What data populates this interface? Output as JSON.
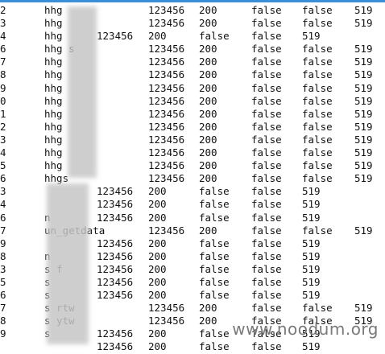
{
  "rows": [
    {
      "line": "2",
      "name": "hhg",
      "c1": "123456",
      "c2": "200",
      "c3": "false",
      "c4": "false",
      "c5": "519",
      "layout": "a"
    },
    {
      "line": "3",
      "name": "hhg",
      "c1": "123456",
      "c2": "200",
      "c3": "false",
      "c4": "false",
      "c5": "519",
      "layout": "a"
    },
    {
      "line": "4",
      "name": "hhg",
      "c1": "123456",
      "c2": "200",
      "c3": "false",
      "c4": "false",
      "c5": "519",
      "layout": "b"
    },
    {
      "line": "6",
      "name": "hhg           s",
      "c1": "123456",
      "c2": "200",
      "c3": "false",
      "c4": "false",
      "c5": "519",
      "layout": "a"
    },
    {
      "line": "7",
      "name": "hhg",
      "c1": "123456",
      "c2": "200",
      "c3": "false",
      "c4": "false",
      "c5": "519",
      "layout": "a"
    },
    {
      "line": "8",
      "name": "hhg",
      "c1": "123456",
      "c2": "200",
      "c3": "false",
      "c4": "false",
      "c5": "519",
      "layout": "a"
    },
    {
      "line": "9",
      "name": "hhg",
      "c1": "123456",
      "c2": "200",
      "c3": "false",
      "c4": "false",
      "c5": "519",
      "layout": "a"
    },
    {
      "line": "0",
      "name": "hhg",
      "c1": "123456",
      "c2": "200",
      "c3": "false",
      "c4": "false",
      "c5": "519",
      "layout": "a"
    },
    {
      "line": "1",
      "name": "hhg",
      "c1": "123456",
      "c2": "200",
      "c3": "false",
      "c4": "false",
      "c5": "519",
      "layout": "a"
    },
    {
      "line": "2",
      "name": "hhg",
      "c1": "123456",
      "c2": "200",
      "c3": "false",
      "c4": "false",
      "c5": "519",
      "layout": "a"
    },
    {
      "line": "3",
      "name": "hhg",
      "c1": "123456",
      "c2": "200",
      "c3": "false",
      "c4": "false",
      "c5": "519",
      "layout": "a"
    },
    {
      "line": "4",
      "name": "hhg",
      "c1": "123456",
      "c2": "200",
      "c3": "false",
      "c4": "false",
      "c5": "519",
      "layout": "a"
    },
    {
      "line": "5",
      "name": "hhg",
      "c1": "123456",
      "c2": "200",
      "c3": "false",
      "c4": "false",
      "c5": "519",
      "layout": "a"
    },
    {
      "line": "6",
      "name": "hhgs",
      "c1": "123456",
      "c2": "200",
      "c3": "false",
      "c4": "false",
      "c5": "519",
      "layout": "a"
    },
    {
      "line": "3",
      "name": "",
      "c1": "123456",
      "c2": "200",
      "c3": "false",
      "c4": "false",
      "c5": "519",
      "layout": "c"
    },
    {
      "line": "4",
      "name": "",
      "c1": "123456",
      "c2": "200",
      "c3": "false",
      "c4": "false",
      "c5": "519",
      "layout": "c"
    },
    {
      "line": "6",
      "name": "     n",
      "c1": "123456",
      "c2": "200",
      "c3": "false",
      "c4": "false",
      "c5": "519",
      "layout": "c"
    },
    {
      "line": "7",
      "name": "     un_getdata",
      "c1": "123456",
      "c2": "200",
      "c3": "false",
      "c4": "false",
      "c5": "519",
      "layout": "a"
    },
    {
      "line": "9",
      "name": "",
      "c1": "123456",
      "c2": "200",
      "c3": "false",
      "c4": "false",
      "c5": "519",
      "layout": "c"
    },
    {
      "line": "8",
      "name": "n",
      "c1": "123456",
      "c2": "200",
      "c3": "false",
      "c4": "false",
      "c5": "519",
      "layout": "c"
    },
    {
      "line": "3",
      "name": "s     f",
      "c1": "123456",
      "c2": "200",
      "c3": "false",
      "c4": "false",
      "c5": "519",
      "layout": "c"
    },
    {
      "line": "5",
      "name": "s",
      "c1": "123456",
      "c2": "200",
      "c3": "false",
      "c4": "false",
      "c5": "519",
      "layout": "c"
    },
    {
      "line": "6",
      "name": "s",
      "c1": "123456",
      "c2": "200",
      "c3": "false",
      "c4": "false",
      "c5": "519",
      "layout": "c"
    },
    {
      "line": "7",
      "name": "s      rtw",
      "c1": "123456",
      "c2": "200",
      "c3": "false",
      "c4": "false",
      "c5": "519",
      "layout": "a"
    },
    {
      "line": "8",
      "name": "s      ytw",
      "c1": "123456",
      "c2": "200",
      "c3": "false",
      "c4": "false",
      "c5": "519",
      "layout": "a"
    },
    {
      "line": "9",
      "name": "s",
      "c1": "123456",
      "c2": "200",
      "c3": "false",
      "c4": "false",
      "c5": "519",
      "layout": "c"
    },
    {
      "line": "",
      "name": "",
      "c1": "123456",
      "c2": "200",
      "c3": "false",
      "c4": "false",
      "c5": "519",
      "layout": "c"
    }
  ],
  "watermark": "www.noodum.org",
  "colors": {
    "text": "#111111",
    "topline": "#3a8fd6",
    "redaction": "#c6c6c6",
    "watermark": "#7a7a7a"
  }
}
